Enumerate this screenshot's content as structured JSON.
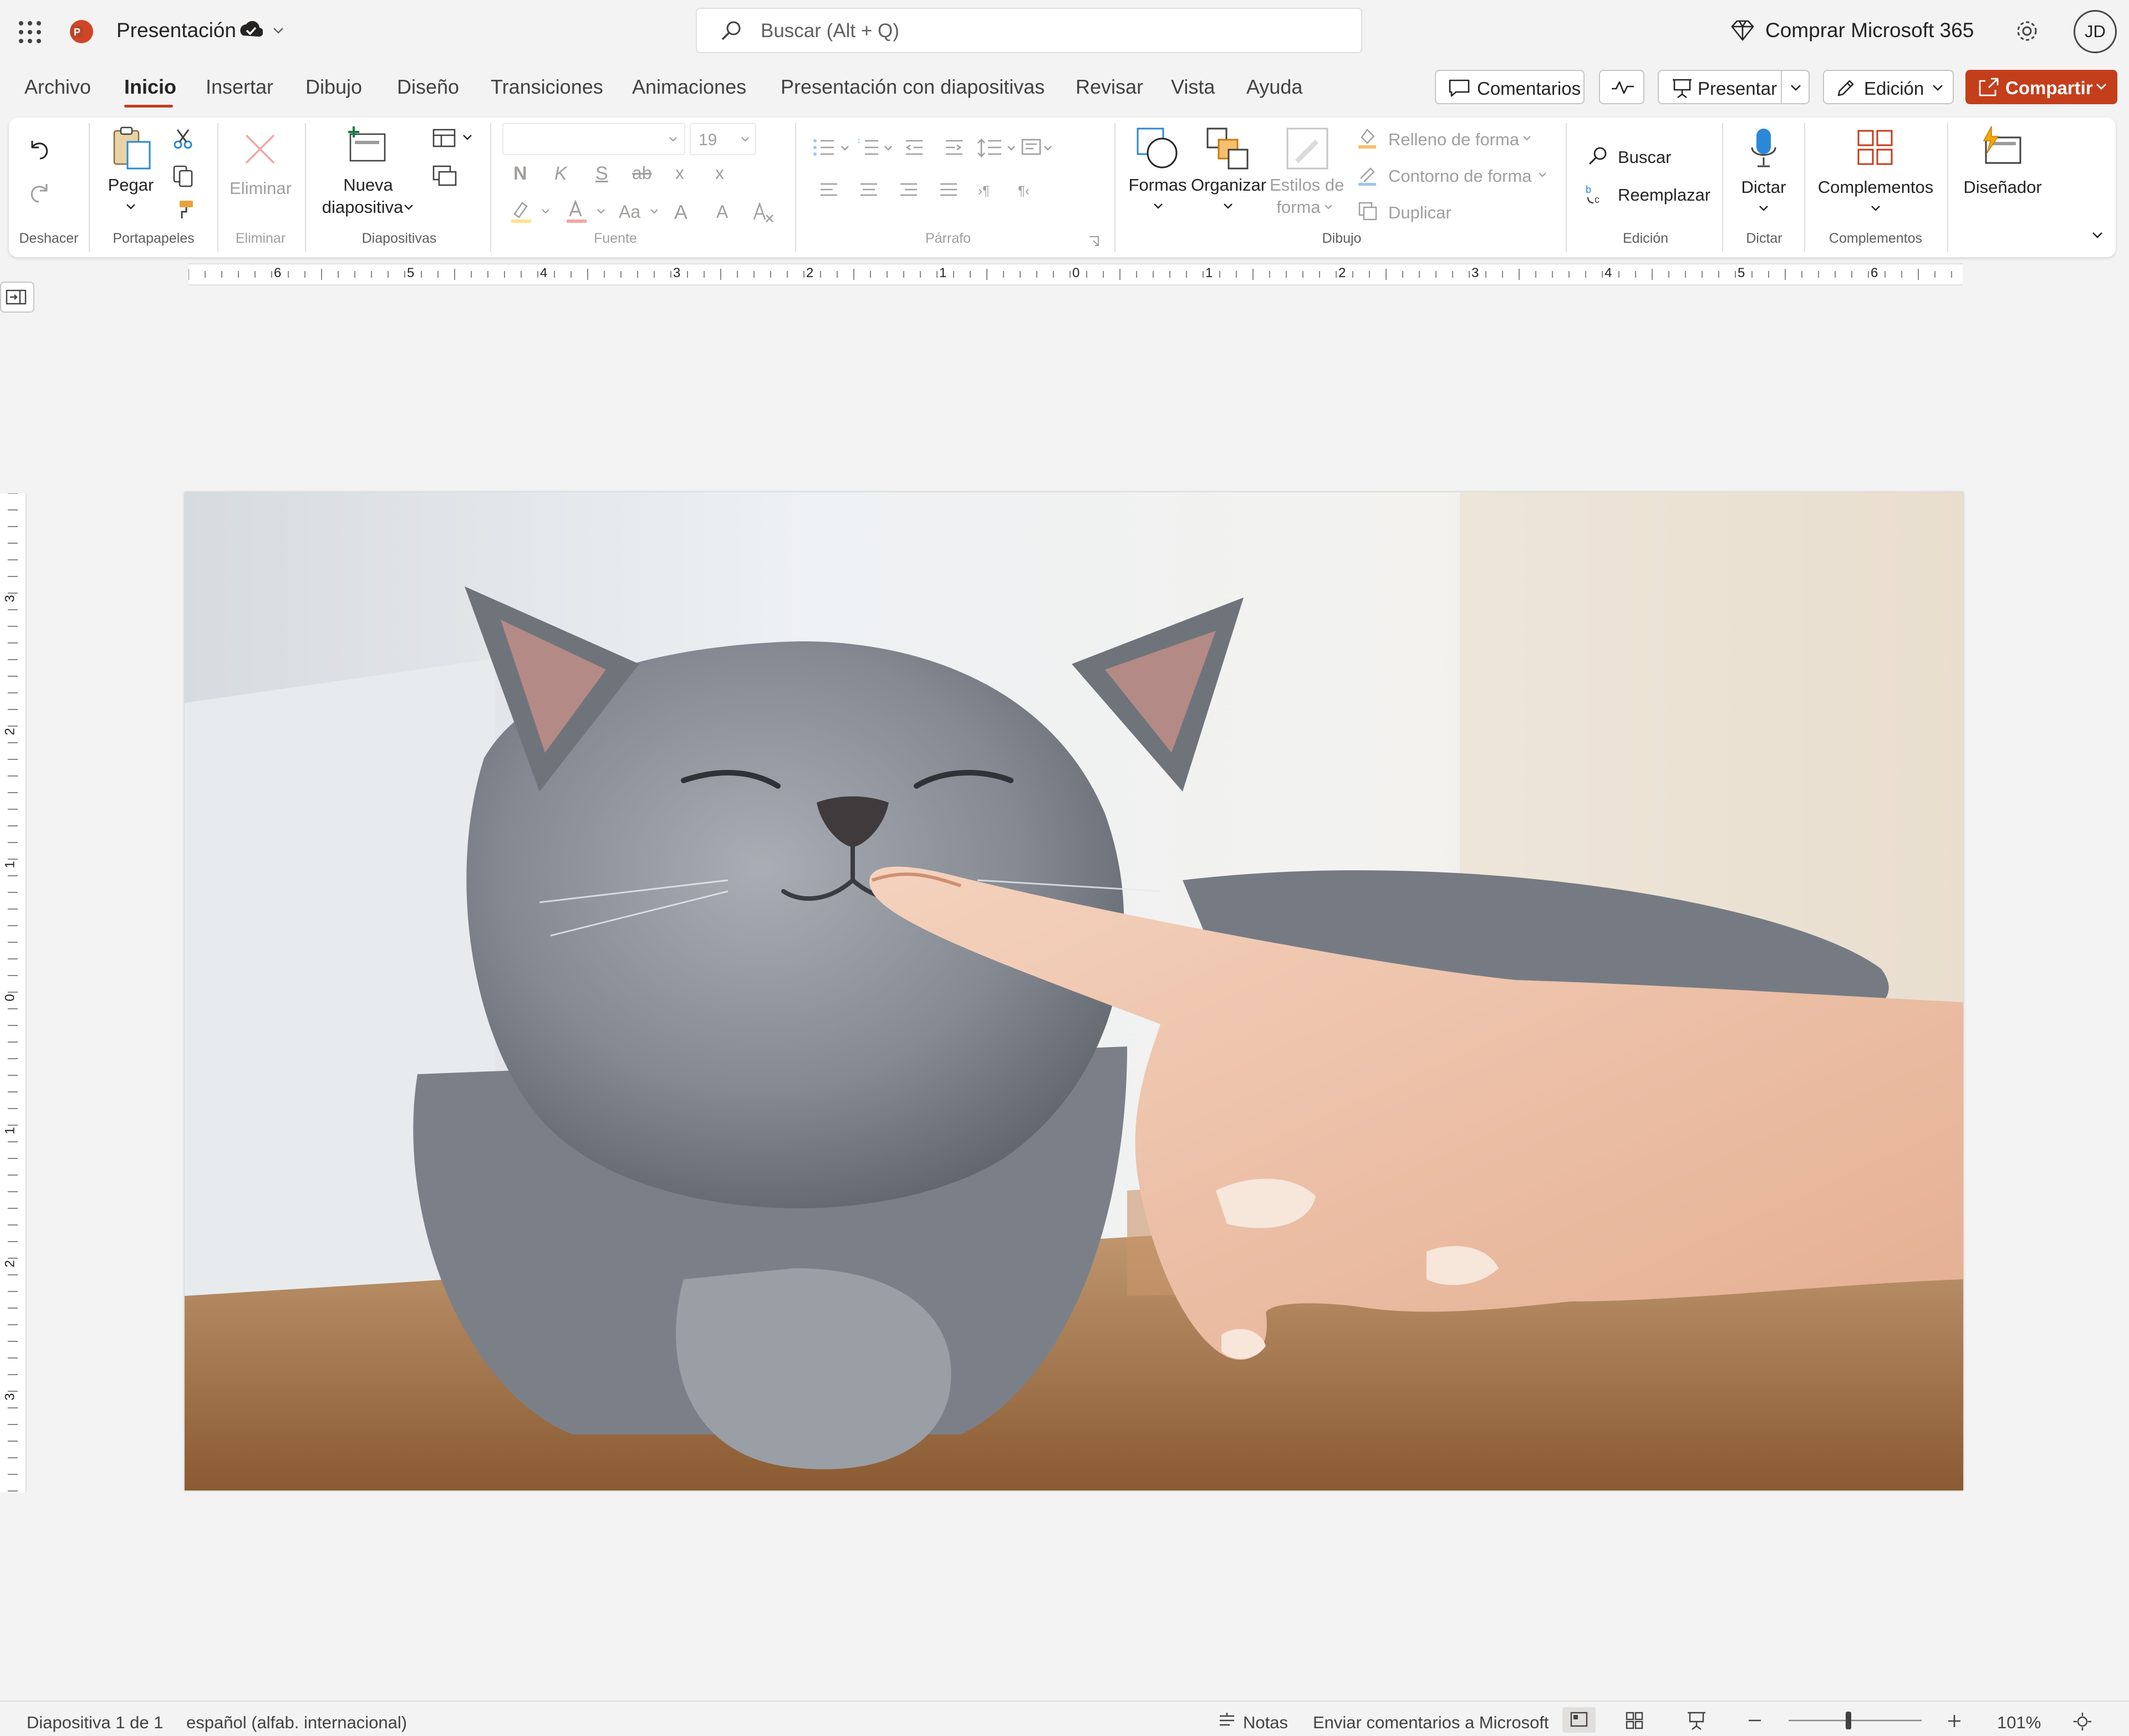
{
  "titlebar": {
    "app_name": "Presentación",
    "search_placeholder": "Buscar (Alt + Q)",
    "buy_label": "Comprar Microsoft 365",
    "avatar_initials": "JD"
  },
  "tabs": [
    "Archivo",
    "Inicio",
    "Insertar",
    "Dibujo",
    "Diseño",
    "Transiciones",
    "Animaciones",
    "Presentación con diapositivas",
    "Revisar",
    "Vista",
    "Ayuda"
  ],
  "active_tab": "Inicio",
  "topbar_buttons": {
    "comments": "Comentarios",
    "present": "Presentar",
    "edit": "Edición",
    "share": "Compartir"
  },
  "ribbon": {
    "groups": {
      "undo": "Deshacer",
      "clipboard": "Portapapeles",
      "delete": "Eliminar",
      "slides": "Diapositivas",
      "font": "Fuente",
      "paragraph": "Párrafo",
      "drawing": "Dibujo",
      "editing": "Edición",
      "dictate": "Dictar",
      "addins": "Complementos"
    },
    "paste": "Pegar",
    "delete_btn": "Eliminar",
    "new_slide_1": "Nueva",
    "new_slide_2": "diapositiva",
    "font_size": "19",
    "bold": "N",
    "italic": "K",
    "underline": "S",
    "strike": "ab",
    "subscript": "x",
    "superscript": "x",
    "change_case": "Aa",
    "grow_font": "A",
    "shrink_font": "A",
    "shapes": "Formas",
    "arrange": "Organizar",
    "styles_1": "Estilos de",
    "styles_2": "forma",
    "fill": "Relleno de forma",
    "outline": "Contorno de forma",
    "duplicate": "Duplicar",
    "find": "Buscar",
    "replace": "Reemplazar",
    "dictate_btn": "Dictar",
    "addins_btn": "Complementos",
    "designer": "Diseñador"
  },
  "ruler": {
    "h_ticks": [
      "6",
      "5",
      "4",
      "3",
      "2",
      "1",
      "0",
      "1",
      "2",
      "3",
      "4",
      "5",
      "6"
    ],
    "v_ticks": [
      "3",
      "2",
      "1",
      "0",
      "1",
      "2",
      "3"
    ]
  },
  "slide": {
    "image_alt": "gato gris recibiendo caricias en la barbilla"
  },
  "statusbar": {
    "slide_info": "Diapositiva 1 de 1",
    "language": "español (alfab. internacional)",
    "notes": "Notas",
    "feedback": "Enviar comentarios a Microsoft",
    "zoom": "101%",
    "zoom_level": 0.45
  },
  "colors": {
    "accent": "#c43e1c",
    "app_icon": "#d04526",
    "ribbon_bg": "#ffffff",
    "chrome_bg": "#f3f3f3"
  },
  "icons": [
    "apps-grid-icon",
    "powerpoint-logo-icon",
    "saved-check-icon",
    "search-icon",
    "diamond-icon",
    "gear-icon",
    "comment-icon",
    "activity-icon",
    "present-icon",
    "pencil-icon",
    "share-icon",
    "undo-icon",
    "redo-icon",
    "paste-icon",
    "cut-icon",
    "copy-icon",
    "format-painter-icon",
    "delete-icon",
    "new-slide-icon",
    "layout-icon",
    "reuse-slide-icon",
    "shapes-icon",
    "arrange-icon",
    "shape-styles-icon",
    "find-icon",
    "replace-icon",
    "microphone-icon",
    "addins-icon",
    "designer-icon",
    "ribbon-collapse-icon"
  ]
}
